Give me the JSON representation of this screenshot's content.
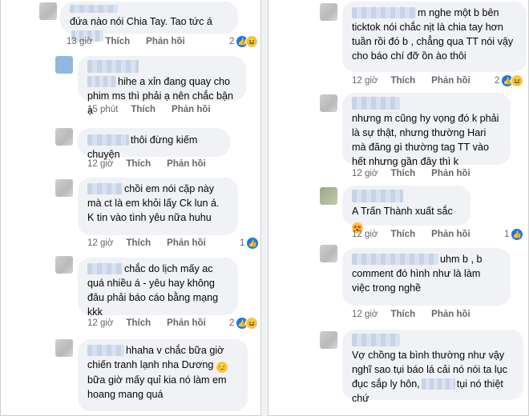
{
  "left": [
    {
      "text": "đứa nào nói Chia Tay. Tao tức á",
      "has_name": false,
      "time": "13 giờ",
      "like_label": "Thích",
      "reply_label": "Phản hồi",
      "reaction_count": "2",
      "emoji": "😆"
    },
    {
      "text": "hihe a xỉn đang quay cho phim ms thì phải ạ nên chắc bận ạ",
      "time": "15 phút",
      "like_label": "Thích",
      "reply_label": "Phản hồi"
    },
    {
      "text": "thôi đừng kiếm chuyện",
      "time": "12 giờ",
      "like_label": "Thích",
      "reply_label": "Phản hồi"
    },
    {
      "text": "chồi em nói cặp này mà ct là em khỏi lấy Ck lun á. K tin vào tình yêu nữa huhu",
      "time": "12 giờ",
      "like_label": "Thích",
      "reply_label": "Phản hồi",
      "reaction_count": "1"
    },
    {
      "text": "chắc do lịch mấy ac quá nhiều á - yêu hay không đâu phải báo cáo bằng mạng kkk",
      "time": "12 giờ",
      "like_label": "Thích",
      "reply_label": "Phản hồi",
      "reaction_count": "2",
      "emoji": "😆"
    },
    {
      "text_a": "hhaha v chắc bữa giờ chiến tranh lạnh nha Dương",
      "emoji_inline": "😏",
      "text_b": "bữa giờ mấy quỉ kia nó làm em hoang mang quá"
    }
  ],
  "right": [
    {
      "text": "m nghe một b bên ticktok nói chắc nịt là chia tay hơn tuần rồi đó b , chẳng qua TT nói vậy cho báo chí đỡ ồn ào thôi",
      "time": "12 giờ",
      "like_label": "Thích",
      "reply_label": "Phản hồi",
      "reaction_count": "2",
      "emoji": "😆"
    },
    {
      "text": "nhưng m cũng hy vọng đó k phải là sự thật, nhưng thường Hari mà đăng gì thường tag TT vào hết nhưng gần đây thì k",
      "time": "12 giờ",
      "like_label": "Thích",
      "reply_label": "Phản hồi"
    },
    {
      "text": "A Trấn Thành xuất sắc",
      "emoji": "😍",
      "time": "12 giờ",
      "like_label": "Thích",
      "reply_label": "Phản hồi",
      "reaction_count": "1"
    },
    {
      "text": "uhm b , b comment đó hình như là làm việc trong nghề",
      "time": "12 giờ",
      "like_label": "Thích",
      "reply_label": "Phản hồi"
    },
    {
      "text_a": "Vợ chồng ta bình thường như vậy nghĩ sao tụi báo lá cải nó nói ta lục đục sắp ly hôn,",
      "text_b": "tụi nó thiệt chứ"
    }
  ],
  "colors": {
    "bubble": "#f0f2f5",
    "meta": "#65676b",
    "like_blue": "#1877f2"
  }
}
